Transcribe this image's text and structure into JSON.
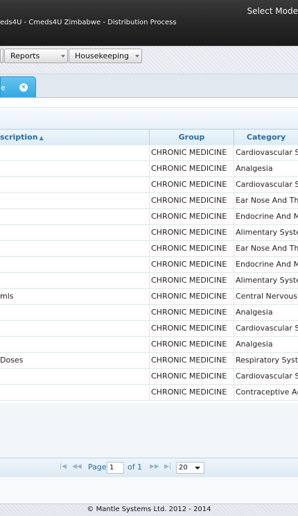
{
  "header": {
    "app_title": "eds4U - Cmeds4U Zimbabwe - Distribution Process",
    "select_mode": "Select Mode"
  },
  "menu": {
    "items": [
      {
        "label": "Reports"
      },
      {
        "label": "Housekeeping"
      }
    ]
  },
  "tab": {
    "label": "e",
    "close_icon": "close-icon"
  },
  "grid": {
    "columns": {
      "description": "scription",
      "group": "Group",
      "category": "Category"
    },
    "sort_icon": "sort-ascending-icon",
    "rows": [
      {
        "description": "",
        "group": "CHRONIC MEDICINE",
        "category": "Cardiovascular Sy"
      },
      {
        "description": "",
        "group": "CHRONIC MEDICINE",
        "category": "Analgesia"
      },
      {
        "description": "",
        "group": "CHRONIC MEDICINE",
        "category": "Cardiovascular Sy"
      },
      {
        "description": "",
        "group": "CHRONIC MEDICINE",
        "category": "Ear Nose And Thr"
      },
      {
        "description": "",
        "group": "CHRONIC MEDICINE",
        "category": "Endocrine And M"
      },
      {
        "description": "",
        "group": "CHRONIC MEDICINE",
        "category": "Alimentary Syster"
      },
      {
        "description": "",
        "group": "CHRONIC MEDICINE",
        "category": "Ear Nose And Thr"
      },
      {
        "description": "",
        "group": "CHRONIC MEDICINE",
        "category": "Endocrine And M"
      },
      {
        "description": "",
        "group": "CHRONIC MEDICINE",
        "category": "Alimentary Syster"
      },
      {
        "description": "mls",
        "group": "CHRONIC MEDICINE",
        "category": "Central Nervous S"
      },
      {
        "description": "",
        "group": "CHRONIC MEDICINE",
        "category": "Analgesia"
      },
      {
        "description": "",
        "group": "CHRONIC MEDICINE",
        "category": "Cardiovascular Sy"
      },
      {
        "description": "",
        "group": "CHRONIC MEDICINE",
        "category": "Analgesia"
      },
      {
        "description": "Doses",
        "group": "CHRONIC MEDICINE",
        "category": "Respiratory Syste"
      },
      {
        "description": "",
        "group": "CHRONIC MEDICINE",
        "category": "Cardiovascular Sy"
      },
      {
        "description": "",
        "group": "CHRONIC MEDICINE",
        "category": "Contraceptive Ag"
      }
    ]
  },
  "pager": {
    "page_label": "Page",
    "page_value": "1",
    "of_label": "of 1",
    "page_size": "20",
    "icons": {
      "first": "first-page-icon",
      "prev": "prev-page-icon",
      "next": "next-page-icon",
      "last": "last-page-icon",
      "dropdown": "chevron-down-icon"
    }
  },
  "footer": {
    "copyright": "© Mantle Systems Ltd. 2012 - 2014"
  },
  "colors": {
    "tab_accent": "#34a8e0",
    "header_text": "#2c6d9e"
  }
}
